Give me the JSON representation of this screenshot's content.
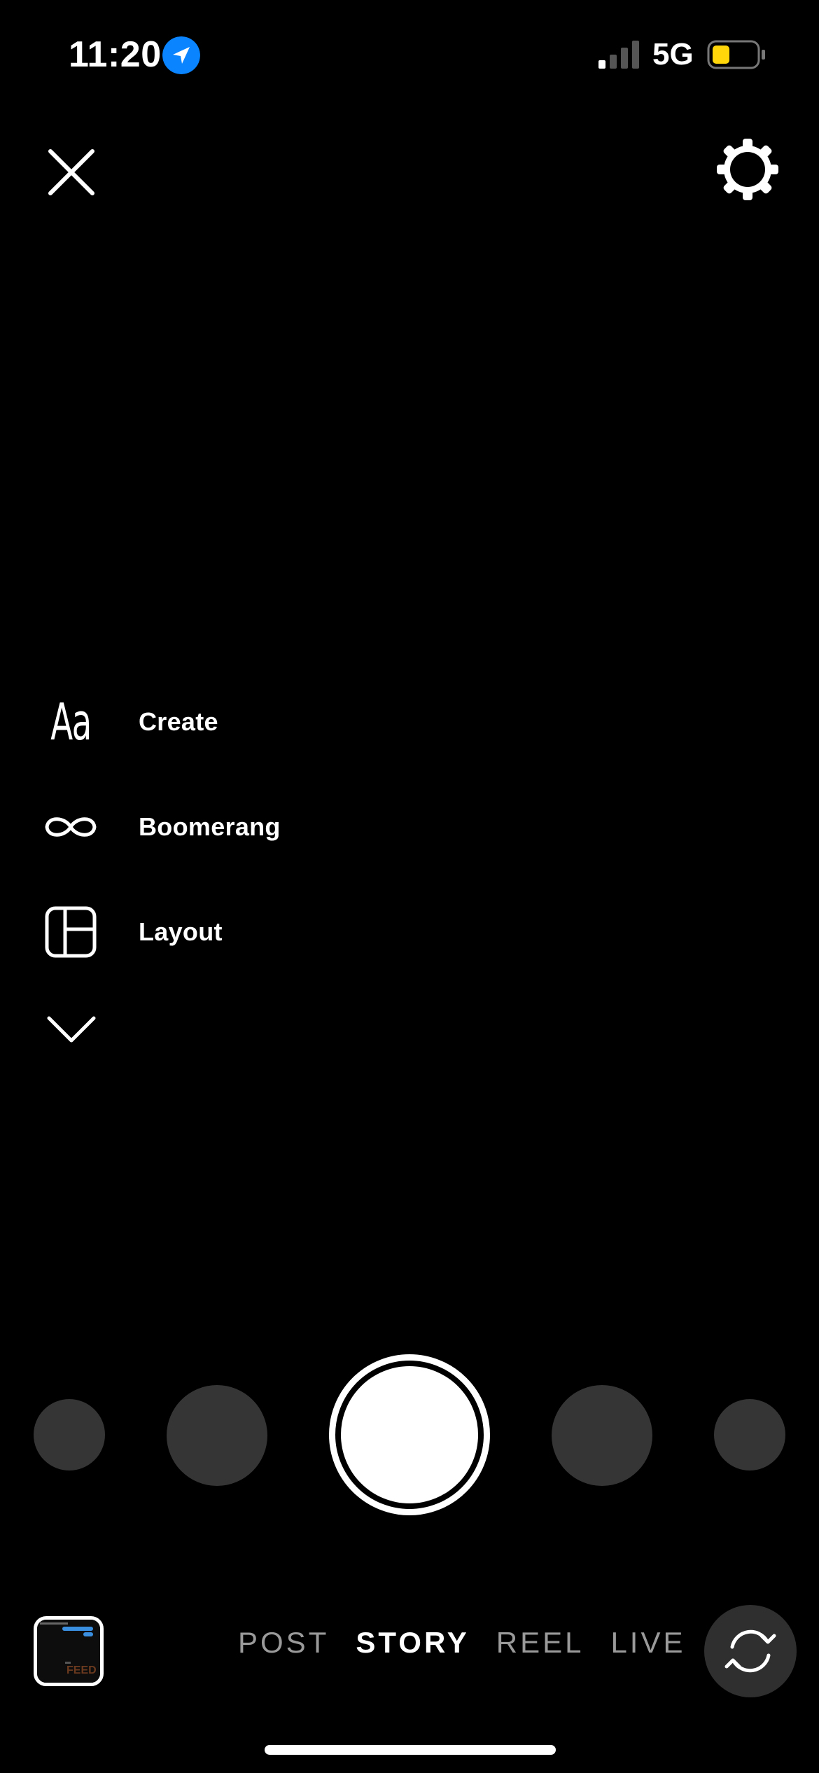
{
  "status_bar": {
    "time": "11:20",
    "network": "5G",
    "location_icon": "location-arrow-icon",
    "battery_color": "#FFD60A",
    "signal_bars_filled": 1,
    "signal_bars_total": 4
  },
  "top_controls": {
    "close_icon": "close-icon",
    "settings_icon": "gear-icon"
  },
  "tools": [
    {
      "label": "Create",
      "icon": "text-aa-icon"
    },
    {
      "label": "Boomerang",
      "icon": "infinity-icon"
    },
    {
      "label": "Layout",
      "icon": "layout-grid-icon"
    }
  ],
  "expand_icon": "chevron-down-icon",
  "gallery": {
    "thumb_text": "FEED"
  },
  "modes": [
    {
      "label": "POST",
      "active": false
    },
    {
      "label": "STORY",
      "active": true
    },
    {
      "label": "REEL",
      "active": false
    },
    {
      "label": "LIVE",
      "active": false
    }
  ],
  "flip_camera_icon": "camera-flip-icon",
  "colors": {
    "background": "#000000",
    "effect_circle": "#353535",
    "location_blue": "#0A84FF",
    "inactive_mode": "#9A9A9A"
  }
}
